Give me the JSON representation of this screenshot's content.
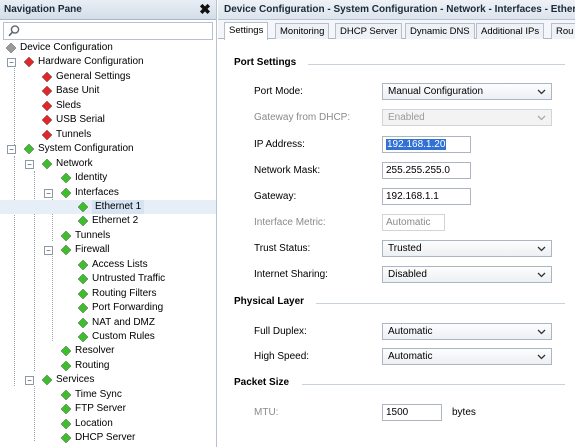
{
  "nav": {
    "title": "Navigation Pane",
    "close_glyph": "✖",
    "search_value": "",
    "items": [
      {
        "label": "Device Configuration",
        "icon": "gray-gem-icon",
        "color": "#9a9a9a",
        "expander": ""
      },
      {
        "label": "Hardware Configuration",
        "icon": "red-gem-icon",
        "color": "#e0282a",
        "expander": "−"
      },
      {
        "label": "General Settings",
        "icon": "red-gem-icon",
        "color": "#e0282a",
        "expander": ""
      },
      {
        "label": "Base Unit",
        "icon": "red-gem-icon",
        "color": "#e0282a",
        "expander": ""
      },
      {
        "label": "Sleds",
        "icon": "red-gem-icon",
        "color": "#e0282a",
        "expander": ""
      },
      {
        "label": "USB Serial",
        "icon": "red-gem-icon",
        "color": "#e0282a",
        "expander": ""
      },
      {
        "label": "Tunnels",
        "icon": "red-gem-icon",
        "color": "#e0282a",
        "expander": ""
      },
      {
        "label": "System Configuration",
        "icon": "green-gem-icon",
        "color": "#3cbf2a",
        "expander": "−"
      },
      {
        "label": "Network",
        "icon": "green-gem-icon",
        "color": "#3cbf2a",
        "expander": "−"
      },
      {
        "label": "Identity",
        "icon": "green-gem-icon",
        "color": "#3cbf2a",
        "expander": ""
      },
      {
        "label": "Interfaces",
        "icon": "green-gem-icon",
        "color": "#3cbf2a",
        "expander": "−"
      },
      {
        "label": "Ethernet 1",
        "icon": "green-gem-icon",
        "color": "#3cbf2a",
        "expander": ""
      },
      {
        "label": "Ethernet 2",
        "icon": "green-gem-icon",
        "color": "#3cbf2a",
        "expander": ""
      },
      {
        "label": "Tunnels",
        "icon": "green-gem-icon",
        "color": "#3cbf2a",
        "expander": ""
      },
      {
        "label": "Firewall",
        "icon": "green-gem-icon",
        "color": "#3cbf2a",
        "expander": "−"
      },
      {
        "label": "Access Lists",
        "icon": "green-gem-icon",
        "color": "#3cbf2a",
        "expander": ""
      },
      {
        "label": "Untrusted Traffic",
        "icon": "green-gem-icon",
        "color": "#3cbf2a",
        "expander": ""
      },
      {
        "label": "Routing Filters",
        "icon": "green-gem-icon",
        "color": "#3cbf2a",
        "expander": ""
      },
      {
        "label": "Port Forwarding",
        "icon": "green-gem-icon",
        "color": "#3cbf2a",
        "expander": ""
      },
      {
        "label": "NAT and DMZ",
        "icon": "green-gem-icon",
        "color": "#3cbf2a",
        "expander": ""
      },
      {
        "label": "Custom Rules",
        "icon": "green-gem-icon",
        "color": "#3cbf2a",
        "expander": ""
      },
      {
        "label": "Resolver",
        "icon": "green-gem-icon",
        "color": "#3cbf2a",
        "expander": ""
      },
      {
        "label": "Routing",
        "icon": "green-gem-icon",
        "color": "#3cbf2a",
        "expander": ""
      },
      {
        "label": "Services",
        "icon": "green-gem-icon",
        "color": "#3cbf2a",
        "expander": "−"
      },
      {
        "label": "Time Sync",
        "icon": "green-gem-icon",
        "color": "#3cbf2a",
        "expander": ""
      },
      {
        "label": "FTP Server",
        "icon": "green-gem-icon",
        "color": "#3cbf2a",
        "expander": ""
      },
      {
        "label": "Location",
        "icon": "green-gem-icon",
        "color": "#3cbf2a",
        "expander": ""
      },
      {
        "label": "DHCP Server",
        "icon": "green-gem-icon",
        "color": "#3cbf2a",
        "expander": ""
      }
    ],
    "selected_label": "Ethernet 1"
  },
  "main": {
    "title": "Device Configuration - System Configuration - Network - Interfaces - Ethern",
    "tabs": [
      "Settings",
      "Monitoring",
      "DHCP Server",
      "Dynamic DNS",
      "Additional IPs",
      "Rou"
    ],
    "active_tab": "Settings"
  },
  "form": {
    "port_settings_title": "Port Settings",
    "port_mode_label": "Port Mode:",
    "port_mode_value": "Manual Configuration",
    "gateway_dhcp_label": "Gateway from DHCP:",
    "gateway_dhcp_value": "Enabled",
    "ip_label": "IP Address:",
    "ip_value": "192.168.1.20",
    "mask_label": "Network Mask:",
    "mask_value": "255.255.255.0",
    "gateway_label": "Gateway:",
    "gateway_value": "192.168.1.1",
    "metric_label": "Interface Metric:",
    "metric_value": "Automatic",
    "trust_label": "Trust Status:",
    "trust_value": "Trusted",
    "sharing_label": "Internet Sharing:",
    "sharing_value": "Disabled",
    "physical_title": "Physical Layer",
    "duplex_label": "Full Duplex:",
    "duplex_value": "Automatic",
    "speed_label": "High Speed:",
    "speed_value": "Automatic",
    "packet_title": "Packet Size",
    "mtu_label": "MTU:",
    "mtu_value": "1500",
    "mtu_unit": "bytes"
  },
  "colors": {
    "selection": "#3170d4",
    "red_gem": "#e0282a",
    "green_gem": "#3cbf2a",
    "gray_gem": "#9a9a9a"
  }
}
